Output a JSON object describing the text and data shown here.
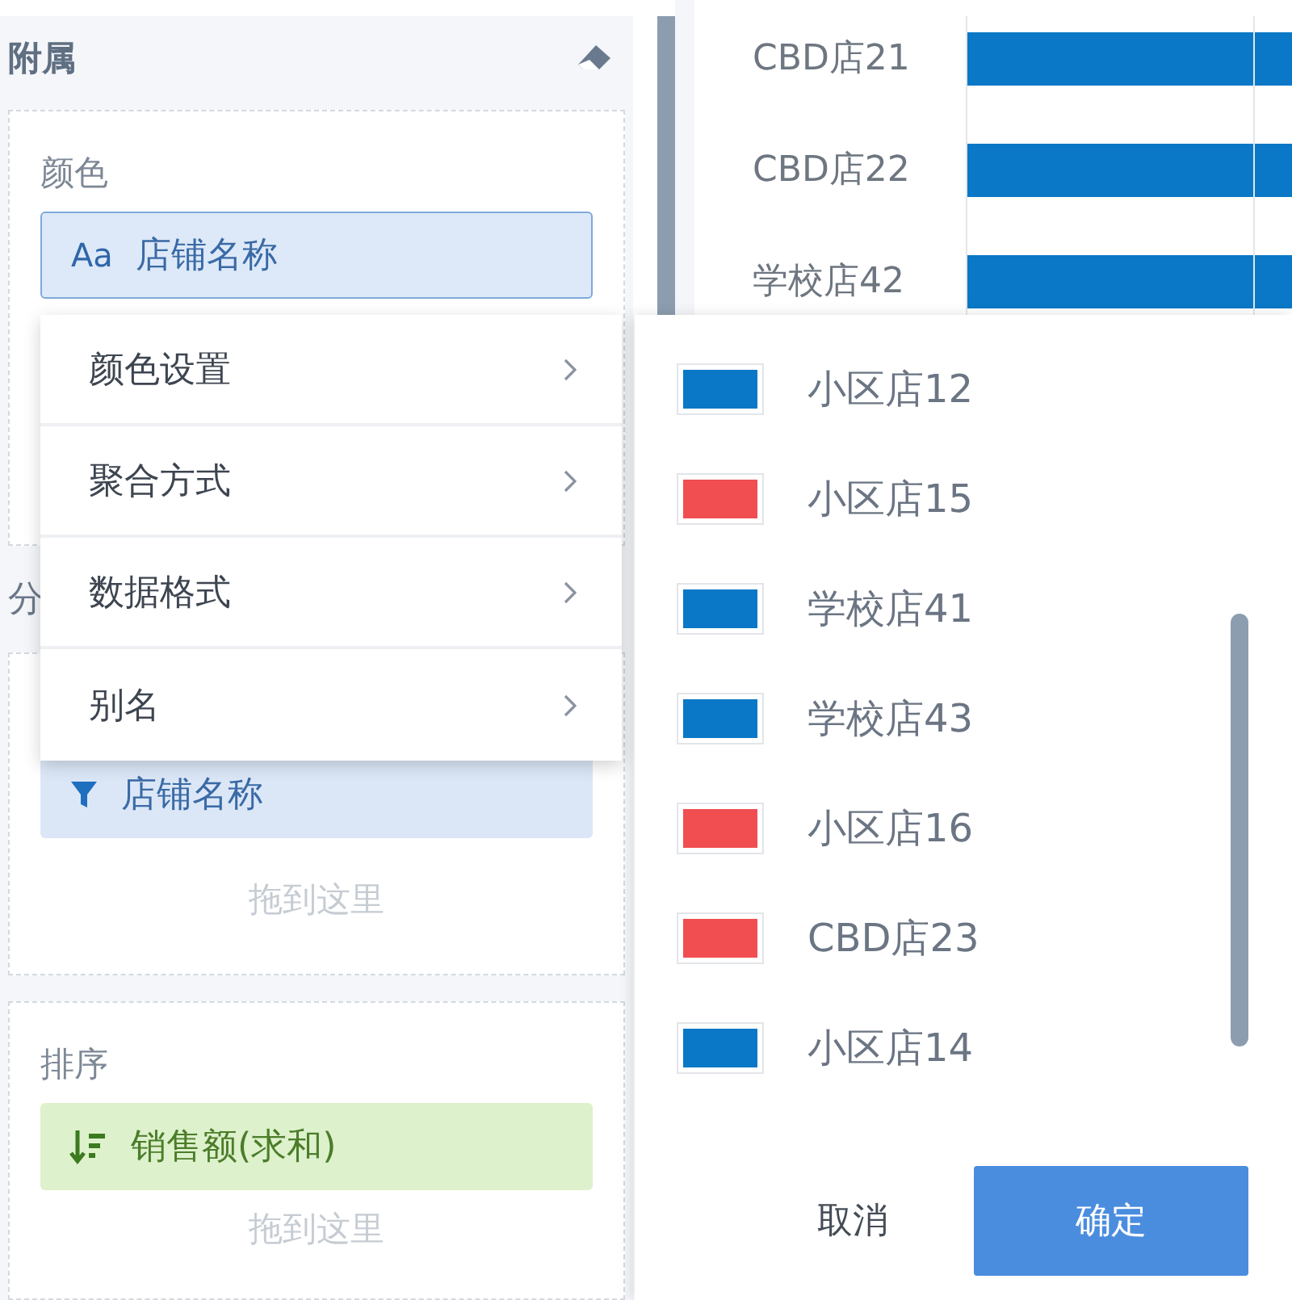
{
  "attributes_panel": {
    "title": "附属",
    "wells": [
      {
        "label": "颜色",
        "fields": [
          {
            "kind": "text",
            "icon_text": "Aa",
            "label": "店铺名称"
          }
        ]
      },
      {
        "heading": "分",
        "fields": [
          {
            "kind": "filter",
            "label": "店铺名称"
          }
        ],
        "drop_hint": "拖到这里"
      },
      {
        "label": "排序",
        "fields": [
          {
            "kind": "sort",
            "label": "销售额(求和)"
          }
        ],
        "drop_hint": "拖到这里"
      }
    ]
  },
  "chart": {
    "categories": [
      "CBD店21",
      "CBD店22",
      "学校店42"
    ]
  },
  "context_menu": {
    "items": [
      {
        "label": "颜色设置",
        "has_submenu": true
      },
      {
        "label": "聚合方式",
        "has_submenu": true
      },
      {
        "label": "数据格式",
        "has_submenu": true
      },
      {
        "label": "别名",
        "has_submenu": true
      }
    ]
  },
  "color_dialog": {
    "items": [
      {
        "label": "小区店12",
        "color": "#0a78c6"
      },
      {
        "label": "小区店15",
        "color": "#f04e51"
      },
      {
        "label": "学校店41",
        "color": "#0a78c6"
      },
      {
        "label": "学校店43",
        "color": "#0a78c6"
      },
      {
        "label": "小区店16",
        "color": "#f04e51"
      },
      {
        "label": "CBD店23",
        "color": "#f04e51"
      },
      {
        "label": "小区店14",
        "color": "#0a78c6"
      }
    ],
    "buttons": [
      {
        "label": "取消",
        "kind": "secondary"
      },
      {
        "label": "确定",
        "kind": "primary"
      }
    ]
  }
}
